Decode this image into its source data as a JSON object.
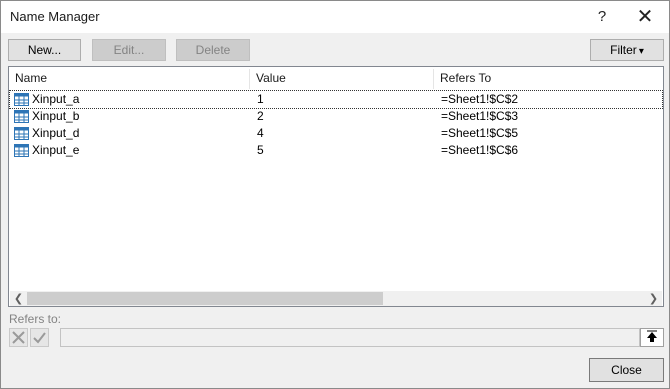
{
  "window": {
    "title": "Name Manager",
    "help_label": "?",
    "close_glyph": "✕"
  },
  "toolbar": {
    "new_label": "New...",
    "edit_label": "Edit...",
    "delete_label": "Delete",
    "filter_label": "Filter",
    "filter_arrow": "▾"
  },
  "table": {
    "columns": [
      "Name",
      "Value",
      "Refers To"
    ],
    "rows": [
      {
        "name": "Xinput_a",
        "value": "1",
        "refers_to": "=Sheet1!$C$2"
      },
      {
        "name": "Xinput_b",
        "value": "2",
        "refers_to": "=Sheet1!$C$3"
      },
      {
        "name": "Xinput_d",
        "value": "4",
        "refers_to": "=Sheet1!$C$5"
      },
      {
        "name": "Xinput_e",
        "value": "5",
        "refers_to": "=Sheet1!$C$6"
      }
    ],
    "scroll_left": "❮",
    "scroll_right": "❯"
  },
  "refers_to": {
    "label": "Refers to:",
    "value": ""
  },
  "footer": {
    "close_label": "Close"
  },
  "colors": {
    "icon_blue": "#2e75b6",
    "border": "#adadad"
  }
}
